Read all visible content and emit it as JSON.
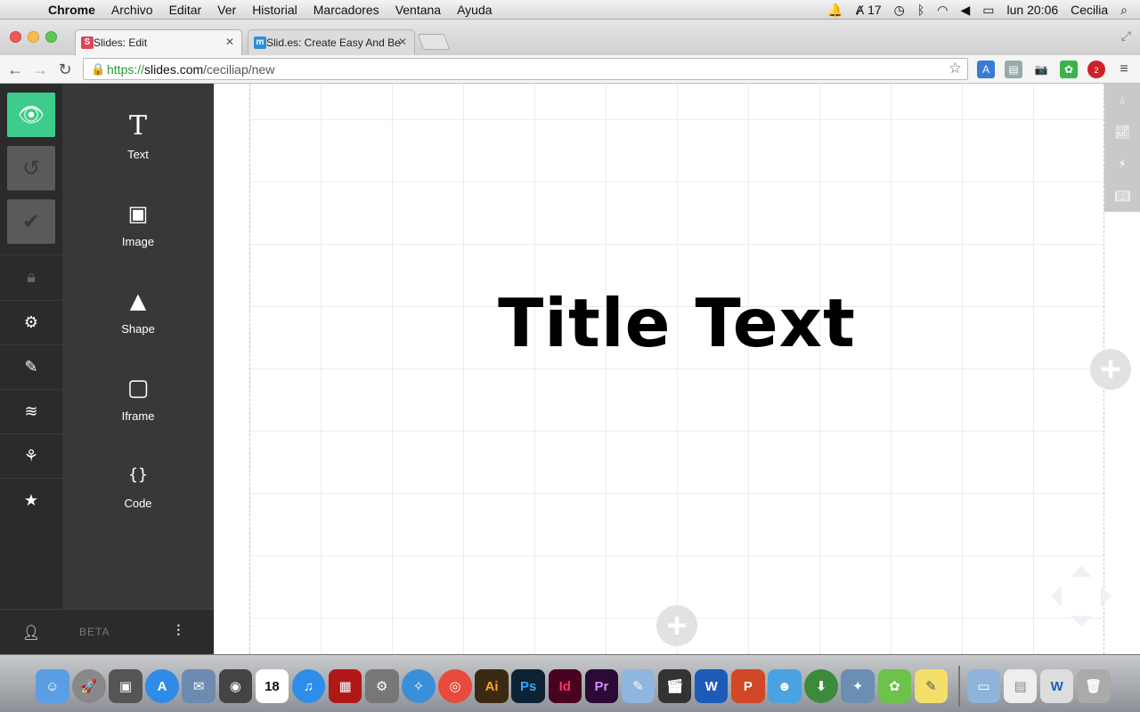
{
  "menubar": {
    "app": "Chrome",
    "items": [
      "Archivo",
      "Editar",
      "Ver",
      "Historial",
      "Marcadores",
      "Ventana",
      "Ayuda"
    ],
    "status": {
      "adobe_count": "17",
      "clock": "lun 20:06",
      "user": "Cecilia"
    }
  },
  "browser": {
    "tabs": [
      {
        "label": "Slides: Edit",
        "favicon_text": "S",
        "favicon_color": "#e0455a"
      },
      {
        "label": "Slid.es: Create Easy And Be",
        "favicon_text": "m",
        "favicon_color": "#2a8fd6"
      }
    ],
    "url": {
      "protocol": "https://",
      "host": "slides.com",
      "path": "/ceciliap/new"
    },
    "ext_badge": "2"
  },
  "sidebar": {
    "icons": [
      "eye-icon",
      "undo-icon",
      "check-icon",
      "lock-icon",
      "gear-icon",
      "brush-icon",
      "layers-icon",
      "tree-icon",
      "star-icon"
    ]
  },
  "tools": [
    {
      "label": "Text",
      "icon": "T"
    },
    {
      "label": "Image",
      "icon": "▣"
    },
    {
      "label": "Shape",
      "icon": "▲"
    },
    {
      "label": "Iframe",
      "icon": "▢"
    },
    {
      "label": "Code",
      "icon": "{}"
    }
  ],
  "footer": {
    "beta": "BETA"
  },
  "slide": {
    "title": "Title Text"
  },
  "dock": {
    "calendar_day": "18"
  },
  "colors": {
    "accent": "#3ecc8d",
    "panel": "#383838",
    "sidebar": "#2b2b2b"
  }
}
